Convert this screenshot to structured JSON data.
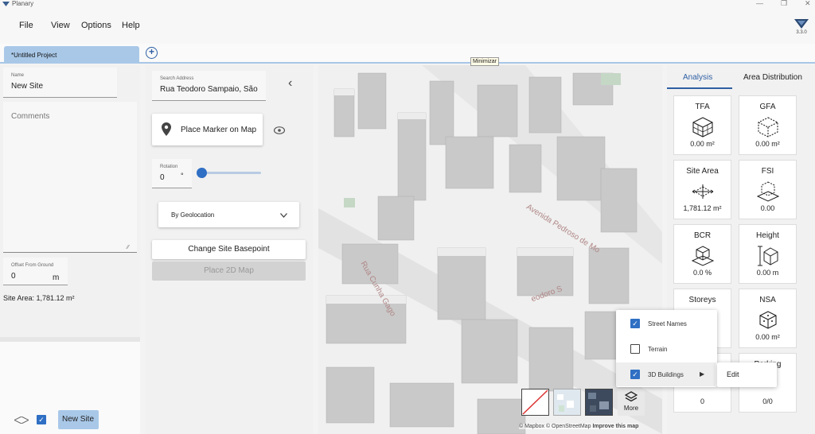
{
  "window": {
    "app_name": "Planary",
    "version": "3.3.0"
  },
  "menu": {
    "items": [
      "File",
      "View",
      "Options",
      "Help"
    ]
  },
  "tabs": {
    "project": "*Untitled Project"
  },
  "tooltip": "Minimizar",
  "left": {
    "name_label": "Name",
    "name_value": "New Site",
    "comments_placeholder": "Comments",
    "offset_label": "Offset From Ground",
    "offset_value": "0",
    "offset_unit": "m",
    "site_area": "Site Area: 1,781.12 m²",
    "site_row_label": "New Site"
  },
  "middle": {
    "search_label": "Search Address",
    "search_value": "Rua Teodoro Sampaio, São",
    "place_marker": "Place Marker on Map",
    "rotation_label": "Rotation",
    "rotation_value": "0",
    "rotation_unit": "°",
    "rotation_level": 0,
    "geolocation": "By Geolocation",
    "change_basepoint": "Change Site Basepoint",
    "place_2d": "Place 2D Map"
  },
  "map": {
    "streets": [
      "Avenida Pedroso de Mo",
      "Rua Cunha Gago",
      "eodoro S"
    ],
    "layers_popup": {
      "items": [
        {
          "label": "Street Names",
          "checked": true
        },
        {
          "label": "Terrain",
          "checked": false
        },
        {
          "label": "3D Buildings",
          "checked": true
        }
      ],
      "submenu": "Edit"
    },
    "more_label": "More",
    "attribution": "© Mapbox © OpenStreetMap",
    "improve": "Improve this map"
  },
  "right": {
    "tabs": [
      "Analysis",
      "Area Distribution"
    ],
    "metrics": [
      {
        "title": "TFA",
        "value": "0.00 m²",
        "icon": "cube-grid-icon"
      },
      {
        "title": "GFA",
        "value": "0.00 m²",
        "icon": "cube-dashed-icon"
      },
      {
        "title": "Site Area",
        "value": "1,781.12 m²",
        "icon": "plot-arrows-icon"
      },
      {
        "title": "FSI",
        "value": "0.00",
        "icon": "cube-plot-icon"
      },
      {
        "title": "BCR",
        "value": "0.0 %",
        "icon": "cube-plot-icon"
      },
      {
        "title": "Height",
        "value": "0.00 m",
        "icon": "height-icon"
      },
      {
        "title": "Storeys",
        "value": "",
        "icon": "storeys-icon"
      },
      {
        "title": "NSA",
        "value": "0.00 m²",
        "icon": "cube-icon"
      },
      {
        "title": "",
        "value": "0",
        "icon": "cube-icon"
      },
      {
        "title": "Parking",
        "value": "0/0",
        "icon": "parking-icon"
      }
    ]
  }
}
